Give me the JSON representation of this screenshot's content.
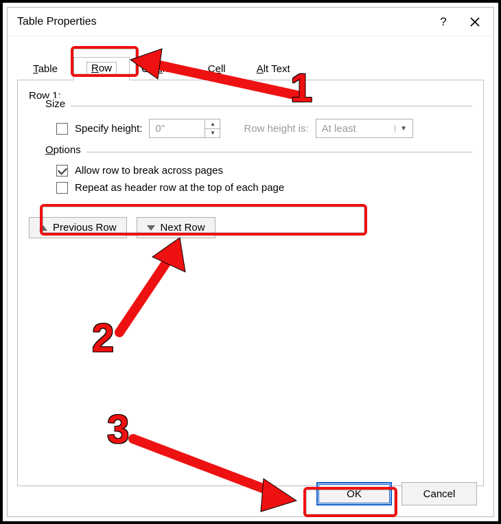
{
  "window": {
    "title": "Table Properties",
    "help_tooltip": "?",
    "close_tooltip": "Close"
  },
  "tabs": {
    "table": "Table",
    "row": "Row",
    "column": "Column",
    "cell": "Cell",
    "alttext": "Alt Text",
    "active": "row"
  },
  "row": {
    "label": "Row 1:",
    "size_legend": "Size",
    "specify_height_label": "Specify height:",
    "height_value": "0\"",
    "row_height_is_label": "Row height is:",
    "row_height_mode": "At least",
    "options_legend": "Options",
    "allow_break": "Allow row to break across pages",
    "repeat_header": "Repeat as header row at the top of each page",
    "prev_row": "Previous Row",
    "next_row": "Next Row"
  },
  "footer": {
    "ok": "OK",
    "cancel": "Cancel"
  },
  "annotations": {
    "n1": "1",
    "n2": "2",
    "n3": "3"
  }
}
